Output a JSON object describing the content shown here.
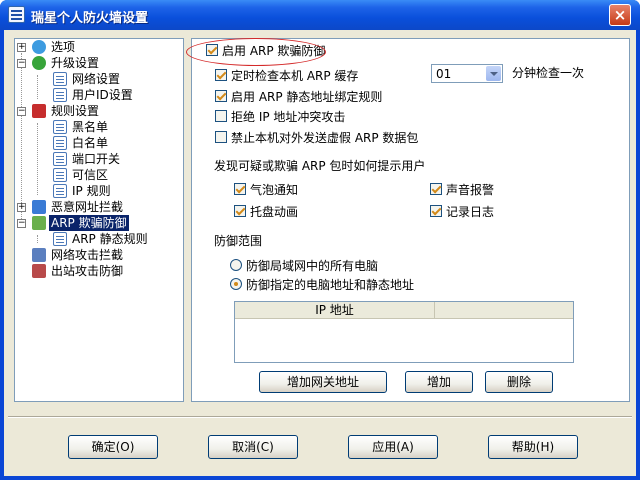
{
  "window": {
    "title": "瑞星个人防火墙设置",
    "close_glyph": "×"
  },
  "tree": {
    "items": [
      {
        "label": "选项"
      },
      {
        "label": "升级设置"
      },
      {
        "label": "网络设置"
      },
      {
        "label": "用户ID设置"
      },
      {
        "label": "规则设置"
      },
      {
        "label": "黑名单"
      },
      {
        "label": "白名单"
      },
      {
        "label": "端口开关"
      },
      {
        "label": "可信区"
      },
      {
        "label": "IP 规则"
      },
      {
        "label": "恶意网址拦截"
      },
      {
        "label": "ARP 欺骗防御"
      },
      {
        "label": "ARP 静态规则"
      },
      {
        "label": "网络攻击拦截"
      },
      {
        "label": "出站攻击防御"
      }
    ]
  },
  "arp": {
    "enable_label": "启用 ARP 欺骗防御",
    "enable_checked": true,
    "options": [
      {
        "label": "定时检查本机 ARP 缓存",
        "checked": true
      },
      {
        "label": "启用 ARP 静态地址绑定规则",
        "checked": true
      },
      {
        "label": "拒绝 IP 地址冲突攻击",
        "checked": false
      },
      {
        "label": "禁止本机对外发送虚假 ARP 数据包",
        "checked": false
      }
    ],
    "interval": {
      "value": "01",
      "suffix": "分钟检查一次"
    },
    "notify_heading": "发现可疑或欺骗 ARP 包时如何提示用户",
    "notify": [
      {
        "label": "气泡通知",
        "checked": true
      },
      {
        "label": "声音报警",
        "checked": true
      },
      {
        "label": "托盘动画",
        "checked": true
      },
      {
        "label": "记录日志",
        "checked": true
      }
    ],
    "scope_heading": "防御范围",
    "scope": [
      {
        "label": "防御局域网中的所有电脑",
        "checked": false
      },
      {
        "label": "防御指定的电脑地址和静态地址",
        "checked": true
      }
    ],
    "ip_list": {
      "column": "IP 地址"
    },
    "buttons": {
      "add_gateway": "增加网关地址",
      "add": "增加",
      "delete": "删除"
    }
  },
  "footer": {
    "ok": "确定(O)",
    "cancel": "取消(C)",
    "apply": "应用(A)",
    "help": "帮助(H)"
  },
  "colors": {
    "titlebar": "#0a4fdb",
    "selection": "#0a246a",
    "dialog_bg": "#ece9d8",
    "check_mark": "#d28a1a",
    "annotation_ellipse": "#d42a2a"
  }
}
